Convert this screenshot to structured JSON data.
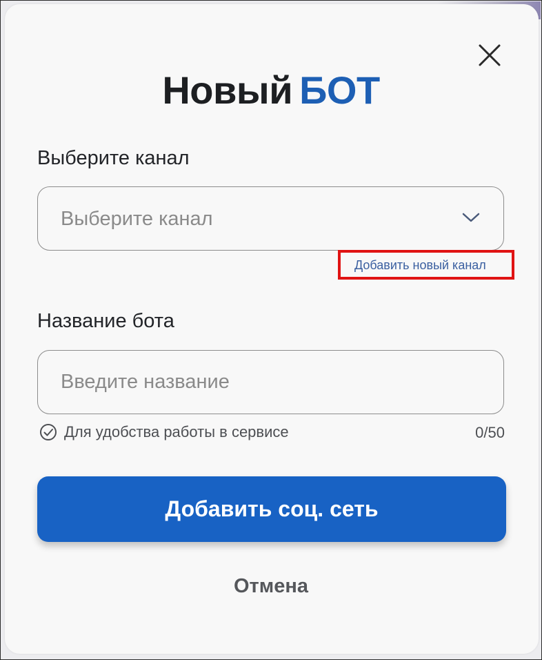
{
  "modal": {
    "title_part1": "Новый",
    "title_part2": "БОТ",
    "title_accent_color": "#1d5fb4"
  },
  "channel": {
    "label": "Выберите канал",
    "select_placeholder": "Выберите канал",
    "add_channel_link": "Добавить новый канал",
    "highlight_color": "#e01313"
  },
  "bot_name": {
    "label": "Название бота",
    "input_placeholder": "Введите название",
    "input_value": "",
    "hint": "Для удобства работы в сервисе",
    "counter": "0/50"
  },
  "actions": {
    "primary_label": "Добавить соц. сеть",
    "primary_color": "#1862c4",
    "cancel_label": "Отмена"
  },
  "icons": {
    "close": "close-icon",
    "dropdown": "chevron-down-icon",
    "hint": "check-circle-icon"
  }
}
